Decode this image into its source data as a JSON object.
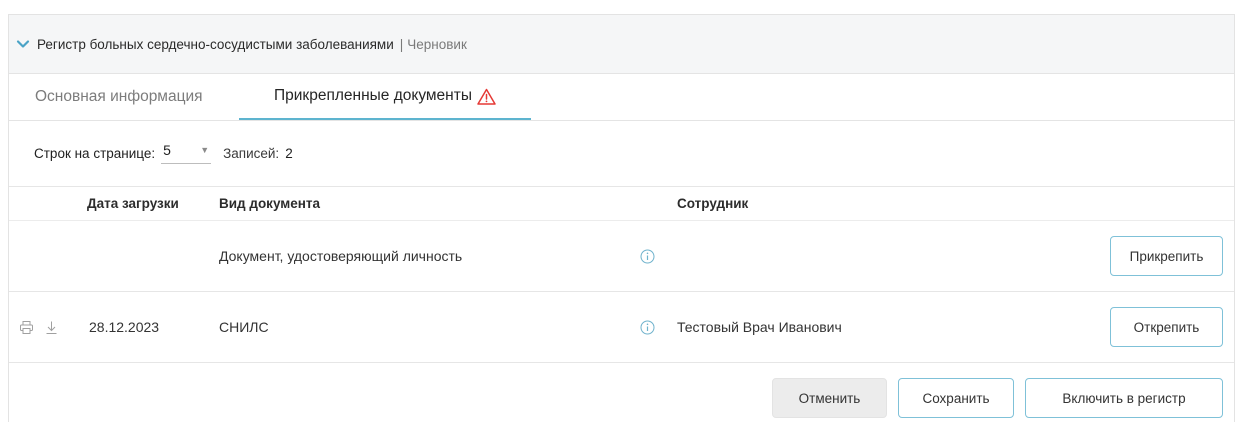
{
  "header": {
    "title": "Регистр больных сердечно-сосудистыми заболеваниями",
    "separator": "|",
    "status": "Черновик"
  },
  "tabs": [
    {
      "label": "Основная информация",
      "active": false
    },
    {
      "label": "Прикрепленные документы",
      "active": true,
      "icon": "warning-icon"
    }
  ],
  "pager": {
    "rows_label": "Строк на странице:",
    "rows_value": "5",
    "records_label": "Записей:",
    "records_count": "2"
  },
  "table": {
    "columns": [
      "Дата загрузки",
      "Вид документа",
      "Сотрудник"
    ],
    "rows": [
      {
        "date": "",
        "doc_type": "Документ, удостоверяющий личность",
        "employee": "",
        "action": "Прикрепить",
        "icons": []
      },
      {
        "date": "28.12.2023",
        "doc_type": "СНИЛС",
        "employee": "Тестовый Врач Иванович",
        "action": "Открепить",
        "icons": [
          "print-icon",
          "download-icon"
        ]
      }
    ]
  },
  "footer": {
    "cancel_label": "Отменить",
    "save_label": "Сохранить",
    "include_label": "Включить в регистр"
  },
  "colors": {
    "accent": "#5db4cf",
    "warning": "#e53935",
    "header_bg": "#f5f6f7",
    "button_border": "#7fc1d8"
  }
}
